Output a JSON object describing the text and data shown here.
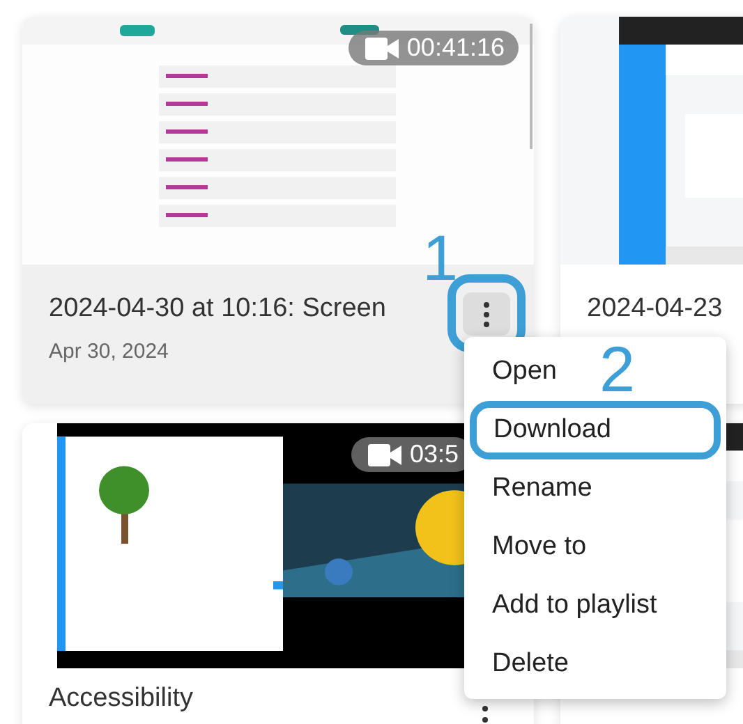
{
  "videos": [
    {
      "title": "2024-04-30 at 10:16: Screen",
      "date": "Apr 30, 2024",
      "duration": "00:41:16",
      "hovered": true
    },
    {
      "title": "2024-04-23",
      "hovered": false
    },
    {
      "title": "Accessibility",
      "duration": "03:5",
      "hovered": false
    },
    {
      "hovered": false
    }
  ],
  "menu": {
    "items": [
      {
        "label": "Open",
        "selected": false
      },
      {
        "label": "Download",
        "selected": true
      },
      {
        "label": "Rename",
        "selected": false
      },
      {
        "label": "Move to",
        "selected": false
      },
      {
        "label": "Add to playlist",
        "selected": false
      },
      {
        "label": "Delete",
        "selected": false
      }
    ]
  },
  "callouts": [
    "1",
    "2"
  ]
}
